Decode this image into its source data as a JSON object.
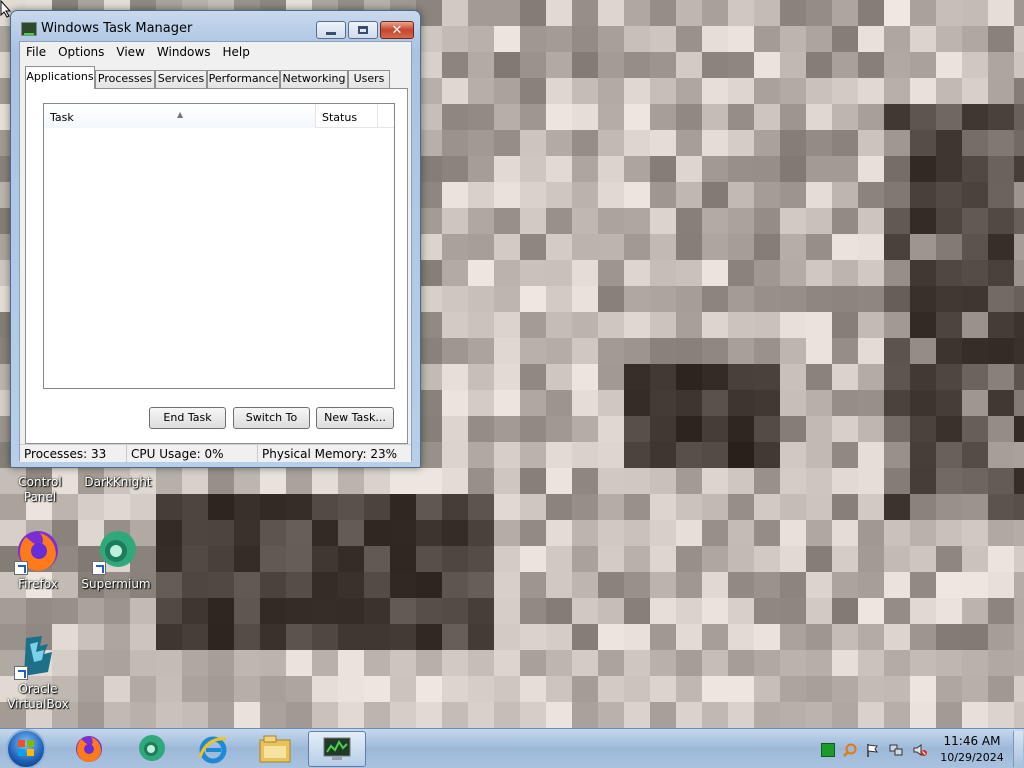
{
  "window": {
    "title": "Windows Task Manager",
    "menu": [
      "File",
      "Options",
      "View",
      "Windows",
      "Help"
    ],
    "tabs": [
      "Applications",
      "Processes",
      "Services",
      "Performance",
      "Networking",
      "Users"
    ],
    "active_tab": "Applications",
    "list_headers": {
      "task": "Task",
      "status": "Status"
    },
    "tasks": [],
    "buttons": {
      "end_task": "End Task",
      "switch_to": "Switch To",
      "new_task": "New Task..."
    },
    "statusbar": {
      "processes": "Processes: 33",
      "cpu": "CPU Usage: 0%",
      "memory": "Physical Memory: 23%"
    },
    "caption_icons": [
      "minimize-icon",
      "maximize-icon",
      "close-icon"
    ]
  },
  "desktop": {
    "partial_labels": {
      "control_panel": "Control Panel",
      "darkknight": "DarkKnight"
    },
    "icons": [
      {
        "label": "Firefox",
        "icon": "firefox-icon"
      },
      {
        "label": "Supermium",
        "icon": "supermium-icon"
      },
      {
        "label": "Oracle VirtualBox",
        "icon": "virtualbox-icon"
      }
    ]
  },
  "taskbar": {
    "pinned": [
      "start-orb",
      "firefox-icon",
      "supermium-icon",
      "internet-explorer-icon",
      "file-explorer-icon",
      "task-manager-icon"
    ],
    "tray_icons": [
      "green-square-icon",
      "magnifier-icon",
      "action-center-flag-icon",
      "network-icon",
      "volume-muted-icon"
    ],
    "clock": {
      "time": "11:46 AM",
      "date": "10/29/2024"
    }
  },
  "colors": {
    "window_frame": "#b9cfe8",
    "close_button": "#c8452b",
    "taskbar": "#a9c2df",
    "wallpaper_base": "#8f8a84"
  }
}
